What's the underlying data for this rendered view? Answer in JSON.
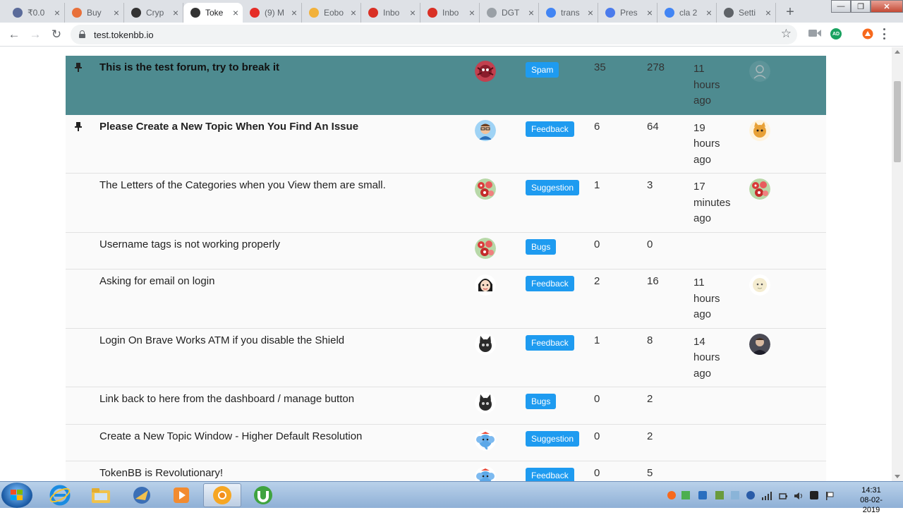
{
  "browser": {
    "tabs": [
      {
        "title": "₹0.0",
        "favicon": "bitbns-icon",
        "color": "#5b6b9a"
      },
      {
        "title": "Buy",
        "favicon": "koinex-icon",
        "color": "#e8703a"
      },
      {
        "title": "Cryp",
        "favicon": "coinmarketcap-icon",
        "color": "#333333"
      },
      {
        "title": "Toke",
        "favicon": "tokenbb-icon",
        "color": "#333333",
        "active": true
      },
      {
        "title": "(9) M",
        "favicon": "youtube-icon",
        "color": "#e52d27"
      },
      {
        "title": "Eobo",
        "favicon": "page-icon",
        "color": "#f2b13a"
      },
      {
        "title": "Inbo",
        "favicon": "gmail-icon",
        "color": "#d93025"
      },
      {
        "title": "Inbo",
        "favicon": "gmail-icon",
        "color": "#d93025"
      },
      {
        "title": "DGT",
        "favicon": "document-icon",
        "color": "#9aa0a6"
      },
      {
        "title": "trans",
        "favicon": "google-icon",
        "color": "#4285f4"
      },
      {
        "title": "Pres",
        "favicon": "presentation-icon",
        "color": "#4b7bec"
      },
      {
        "title": "cla 2",
        "favicon": "google-icon",
        "color": "#4285f4"
      },
      {
        "title": "Setti",
        "favicon": "gear-icon",
        "color": "#5f6368"
      }
    ],
    "url": "test.tokenbb.io"
  },
  "forum": {
    "topics": [
      {
        "title": "This is the test forum, try to break it",
        "pinned": true,
        "highlighted": true,
        "avatar": "spider-avatar",
        "category": "Spam",
        "replies": "35",
        "views": "278",
        "activity": [
          "11",
          "hours",
          "ago"
        ],
        "last_avatar": "faded-avatar"
      },
      {
        "title": "Please Create a New Topic When You Find An Issue",
        "pinned": true,
        "avatar": "man-glasses-avatar",
        "category": "Feedback",
        "replies": "6",
        "views": "64",
        "activity": [
          "19",
          "hours",
          "ago"
        ],
        "last_avatar": "cat-avatar"
      },
      {
        "title": "The Letters of the Categories when you View them are small.",
        "avatar": "flowers-avatar",
        "category": "Suggestion",
        "replies": "1",
        "views": "3",
        "activity": [
          "17",
          "minutes",
          "ago"
        ],
        "last_avatar": "flowers-avatar"
      },
      {
        "title": "Username tags is not working properly",
        "avatar": "flowers-avatar",
        "category": "Bugs",
        "replies": "0",
        "views": "0",
        "activity": [],
        "last_avatar": ""
      },
      {
        "title": "Asking for email on login",
        "avatar": "anime-girl-avatar",
        "category": "Feedback",
        "replies": "2",
        "views": "16",
        "activity": [
          "11",
          "hours",
          "ago"
        ],
        "last_avatar": "sheep-avatar"
      },
      {
        "title": "Login On Brave Works ATM if you disable the Shield",
        "avatar": "black-cat-avatar",
        "category": "Feedback",
        "replies": "1",
        "views": "8",
        "activity": [
          "14",
          "hours",
          "ago"
        ],
        "last_avatar": "man-photo-avatar"
      },
      {
        "title": "Link back to here from the dashboard / manage button",
        "avatar": "black-cat-avatar",
        "category": "Bugs",
        "replies": "0",
        "views": "2",
        "activity": [],
        "last_avatar": ""
      },
      {
        "title": "Create a New Topic Window - Higher Default Resolution",
        "avatar": "blue-elephant-avatar",
        "category": "Suggestion",
        "replies": "0",
        "views": "2",
        "activity": [],
        "last_avatar": ""
      },
      {
        "title": "TokenBB is Revolutionary!",
        "avatar": "blue-elephant-avatar",
        "category": "Feedback",
        "replies": "0",
        "views": "5",
        "activity": [],
        "last_avatar": ""
      }
    ]
  },
  "taskbar": {
    "time": "14:31",
    "date": "08-02-2019"
  },
  "colors": {
    "highlight_row": "#4e8b90",
    "badge": "#1e9bf0"
  }
}
